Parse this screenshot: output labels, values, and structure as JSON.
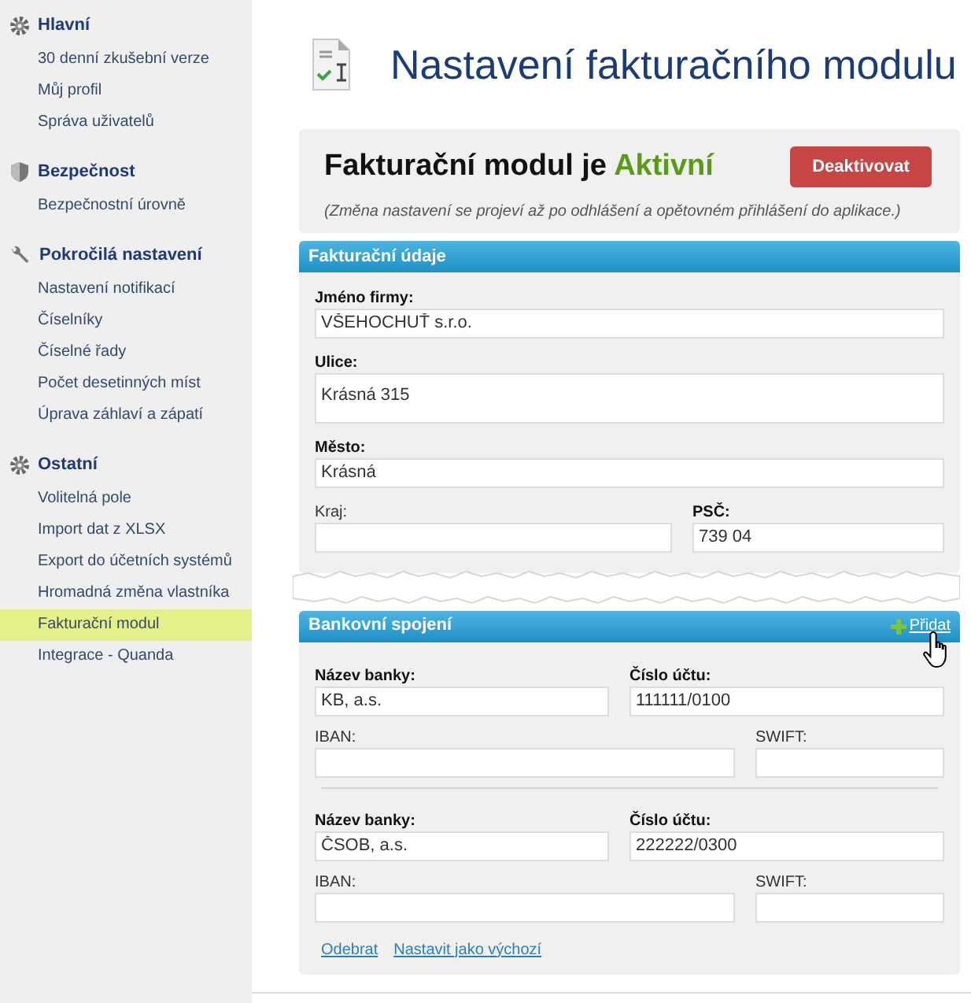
{
  "sidebar": {
    "groups": [
      {
        "title": "Hlavní",
        "items": [
          {
            "label": "30 denní zkušební verze",
            "selected": false
          },
          {
            "label": "Můj profil",
            "selected": false
          },
          {
            "label": "Správa uživatelů",
            "selected": false
          }
        ]
      },
      {
        "title": "Bezpečnost",
        "items": [
          {
            "label": "Bezpečnostní úrovně",
            "selected": false
          }
        ]
      },
      {
        "title": "Pokročilá nastavení",
        "items": [
          {
            "label": "Nastavení notifikací",
            "selected": false
          },
          {
            "label": "Číselníky",
            "selected": false
          },
          {
            "label": "Číselné řady",
            "selected": false
          },
          {
            "label": "Počet desetinných míst",
            "selected": false
          },
          {
            "label": "Úprava záhlaví a zápatí",
            "selected": false
          }
        ]
      },
      {
        "title": "Ostatní",
        "items": [
          {
            "label": "Volitelná pole",
            "selected": false
          },
          {
            "label": "Import dat z XLSX",
            "selected": false
          },
          {
            "label": "Export do účetních systémů",
            "selected": false
          },
          {
            "label": "Hromadná změna vlastníka",
            "selected": false
          },
          {
            "label": "Fakturační modul",
            "selected": true
          },
          {
            "label": "Integrace - Quanda",
            "selected": false
          }
        ]
      }
    ]
  },
  "page_title": "Nastavení fakturačního modulu",
  "status": {
    "label": "Fakturační modul je",
    "value": "Aktivní",
    "active": true,
    "button": "Deaktivovat",
    "note": "(Změna nastavení se projeví až po odhlášení a opětovném přihlášení do aplikace.)"
  },
  "billing": {
    "title": "Fakturační údaje",
    "fields": [
      {
        "label": "Jméno firmy:",
        "value": "VŠEHOCHUŤ s.r.o.",
        "required": true,
        "kind": "input"
      },
      {
        "label": "Ulice:",
        "value": "Krásná 315",
        "required": true,
        "kind": "textarea"
      },
      {
        "label": "Město:",
        "value": "Krásná",
        "required": true,
        "kind": "input"
      },
      {
        "label": "Kraj:",
        "required": false,
        "kind": "input"
      },
      {
        "label": "PSČ:",
        "value": "739 04",
        "required": true,
        "kind": "input"
      }
    ]
  },
  "bank": {
    "title": "Bankovní spojení",
    "add_link": "Přidat",
    "accounts": [
      {
        "bank_label": "Název banky:",
        "bank_name": "KB, a.s.",
        "account_label": "Číslo účtu:",
        "account": "111111/0100",
        "iban_label": "IBAN:",
        "swift_label": "SWIFT:"
      },
      {
        "bank_label": "Název banky:",
        "bank_name": "ČSOB, a.s.",
        "account_label": "Číslo účtu:",
        "account": "222222/0300",
        "iban_label": "IBAN:",
        "swift_label": "SWIFT:",
        "links": [
          "Odebrat",
          "Nastavit jako výchozí"
        ]
      }
    ]
  }
}
